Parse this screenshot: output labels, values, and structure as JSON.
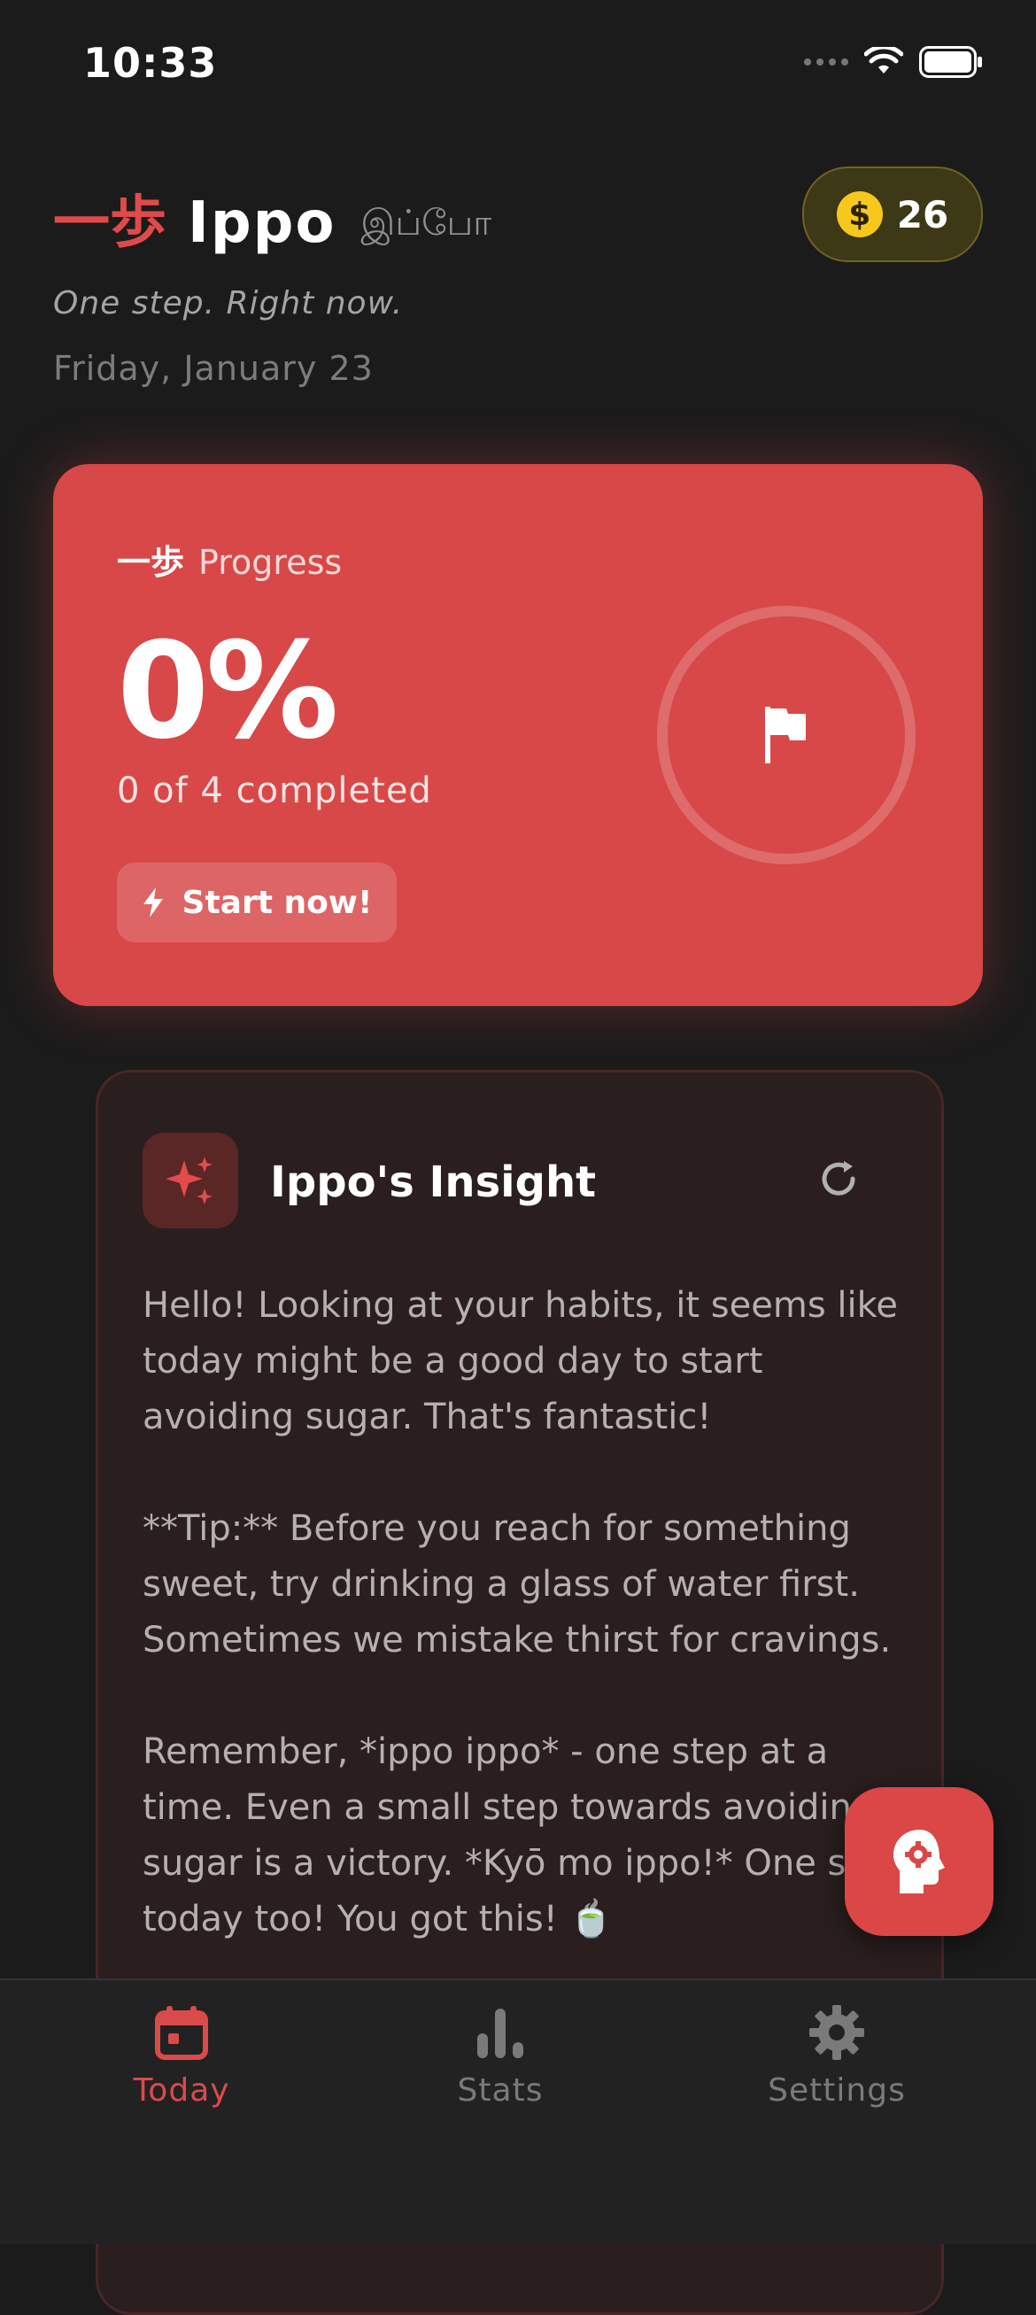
{
  "status_bar": {
    "time": "10:33"
  },
  "header": {
    "brand_kanji": "一歩",
    "brand_name": "Ippo",
    "brand_tamil": "இப்போ",
    "tagline": "One step. Right now.",
    "date": "Friday, January 23",
    "coin_symbol": "$",
    "coins": "26"
  },
  "progress": {
    "label_kanji": "一歩",
    "label": "Progress",
    "percent": "0%",
    "percent_value": 0,
    "subtitle": "0 of 4 completed",
    "start_button": "Start now!"
  },
  "insight": {
    "title": "Ippo's Insight",
    "paragraphs": [
      "Hello! Looking at your habits, it seems like today might be a good day to start avoiding sugar. That's fantastic!",
      "**Tip:** Before you reach for something sweet, try drinking a glass of water first. Sometimes we mistake thirst for cravings.",
      "Remember, *ippo ippo* - one step at a time. Even a small step towards avoiding sugar is a victory. *Kyō mo ippo!* One step today too! You got this! 🍵"
    ]
  },
  "tabs": [
    {
      "label": "Today",
      "icon": "calendar-icon",
      "active": true
    },
    {
      "label": "Stats",
      "icon": "bar-chart-icon",
      "active": false
    },
    {
      "label": "Settings",
      "icon": "gear-icon",
      "active": false
    }
  ],
  "colors": {
    "accent": "#db4646",
    "background": "#1b1b1b",
    "coin": "#f7c81c"
  }
}
